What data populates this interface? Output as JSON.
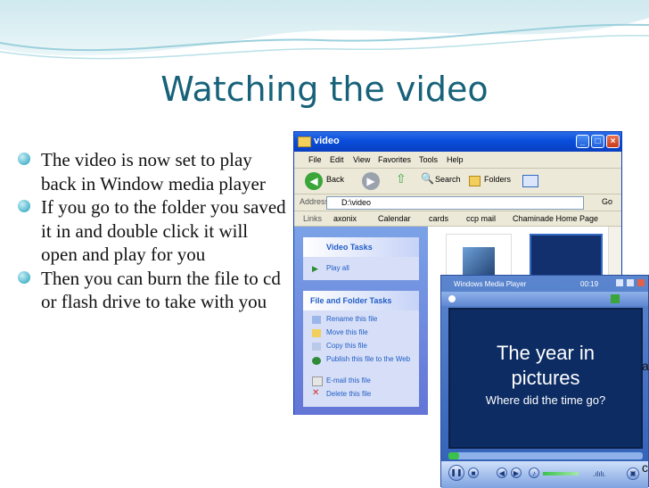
{
  "slide": {
    "title": "Watching the video",
    "bullets": [
      "The video is now set to play back in Window media player",
      "If you go to the folder you saved it in and double click it will open and play for you",
      "Then you can burn the file to cd or flash drive to take with you"
    ],
    "side_fragments": [
      "a",
      "c"
    ]
  },
  "explorer": {
    "title": "video",
    "menu": [
      "File",
      "Edit",
      "View",
      "Favorites",
      "Tools",
      "Help"
    ],
    "toolbar": {
      "back": "Back",
      "search": "Search",
      "folders": "Folders"
    },
    "address_label": "Address",
    "address_value": "D:\\video",
    "go": "Go",
    "links_label": "Links",
    "links": [
      "axonix",
      "Calendar",
      "cards",
      "ccp mail",
      "Chaminade Home Page"
    ],
    "video_tasks": {
      "heading": "Video Tasks",
      "items": [
        "Play all"
      ]
    },
    "file_tasks": {
      "heading": "File and Folder Tasks",
      "items": [
        "Rename this file",
        "Move this file",
        "Copy this file",
        "Publish this file to the Web",
        "E-mail this file",
        "Delete this file"
      ]
    }
  },
  "wmp": {
    "title": "Windows Media Player",
    "time": "00:19",
    "video_text": {
      "line1": "The year in",
      "line2": "pictures",
      "line3": "Where did the time go?"
    }
  },
  "colors": {
    "title": "#17627a",
    "xp_blue": "#0a4ddb",
    "task_link": "#215dc6",
    "video_bg": "#0c2c63"
  }
}
